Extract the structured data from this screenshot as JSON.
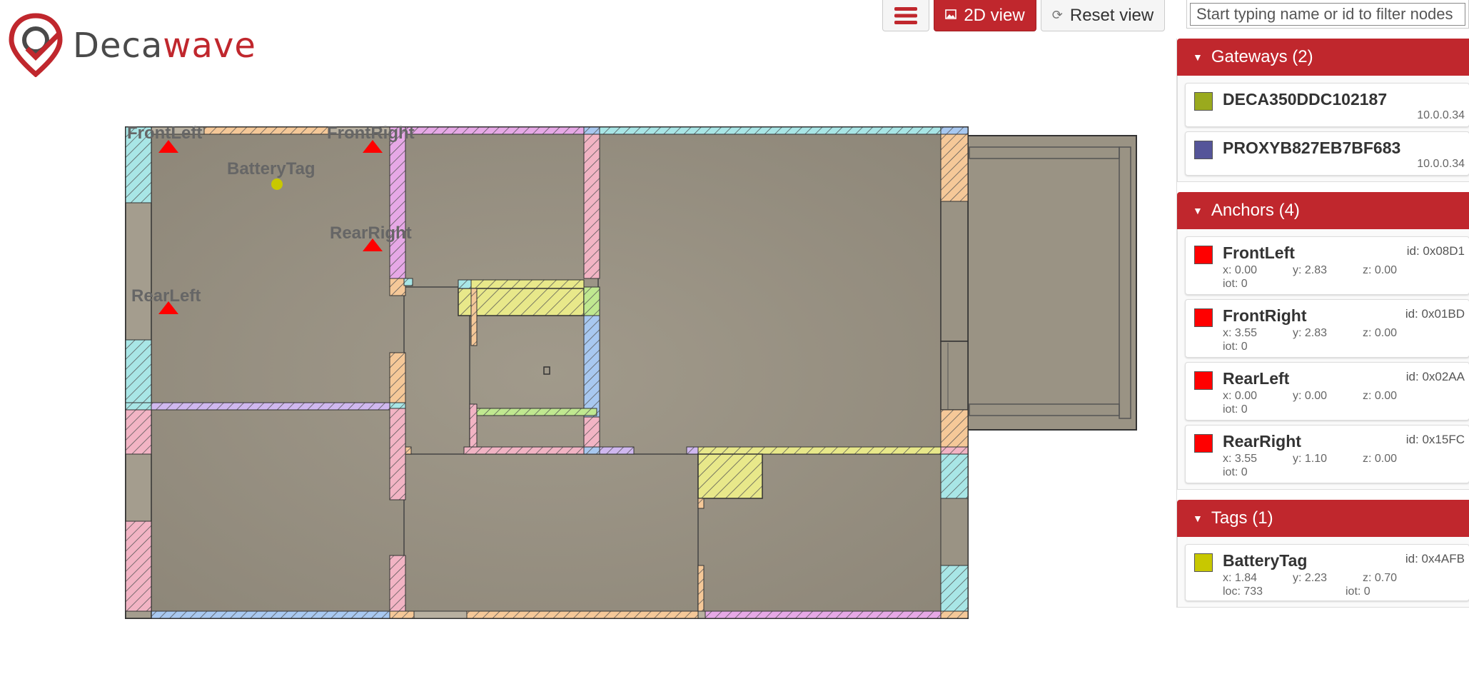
{
  "brand": {
    "name_part1": "Deca",
    "name_part2": "wave",
    "accent": "#c0272d"
  },
  "toolbar": {
    "menu_icon": "hamburger-icon",
    "view_label": "2D view",
    "view_icon": "image-icon",
    "reset_label": "Reset view",
    "reset_icon": "refresh-icon"
  },
  "filter": {
    "placeholder": "Start typing name or id to filter nodes",
    "value": ""
  },
  "gateways": {
    "header": "Gateways (2)",
    "items": [
      {
        "name": "DECA350DDC102187",
        "ip": "10.0.0.34",
        "color": "#9aaa1e"
      },
      {
        "name": "PROXYB827EB7BF683",
        "ip": "10.0.0.34",
        "color": "#555599"
      }
    ]
  },
  "anchors": {
    "header": "Anchors (4)",
    "items": [
      {
        "name": "FrontLeft",
        "id": "id: 0x08D1",
        "x": "x: 0.00",
        "y": "y: 2.83",
        "z": "z: 0.00",
        "iot": "iot: 0",
        "color": "#ff0000"
      },
      {
        "name": "FrontRight",
        "id": "id: 0x01BD",
        "x": "x: 3.55",
        "y": "y: 2.83",
        "z": "z: 0.00",
        "iot": "iot: 0",
        "color": "#ff0000"
      },
      {
        "name": "RearLeft",
        "id": "id: 0x02AA",
        "x": "x: 0.00",
        "y": "y: 0.00",
        "z": "z: 0.00",
        "iot": "iot: 0",
        "color": "#ff0000"
      },
      {
        "name": "RearRight",
        "id": "id: 0x15FC",
        "x": "x: 3.55",
        "y": "y: 1.10",
        "z": "z: 0.00",
        "iot": "iot: 0",
        "color": "#ff0000"
      }
    ]
  },
  "tags": {
    "header": "Tags (1)",
    "items": [
      {
        "name": "BatteryTag",
        "id": "id: 0x4AFB",
        "x": "x: 1.84",
        "y": "y: 2.23",
        "z": "z: 0.70",
        "loc": "loc: 733",
        "iot": "iot: 0",
        "color": "#c8c800"
      }
    ]
  },
  "map": {
    "labels": {
      "front_left": "FrontLeft",
      "front_right": "FrontRight",
      "rear_left": "RearLeft",
      "rear_right": "RearRight",
      "battery_tag": "BatteryTag"
    }
  }
}
